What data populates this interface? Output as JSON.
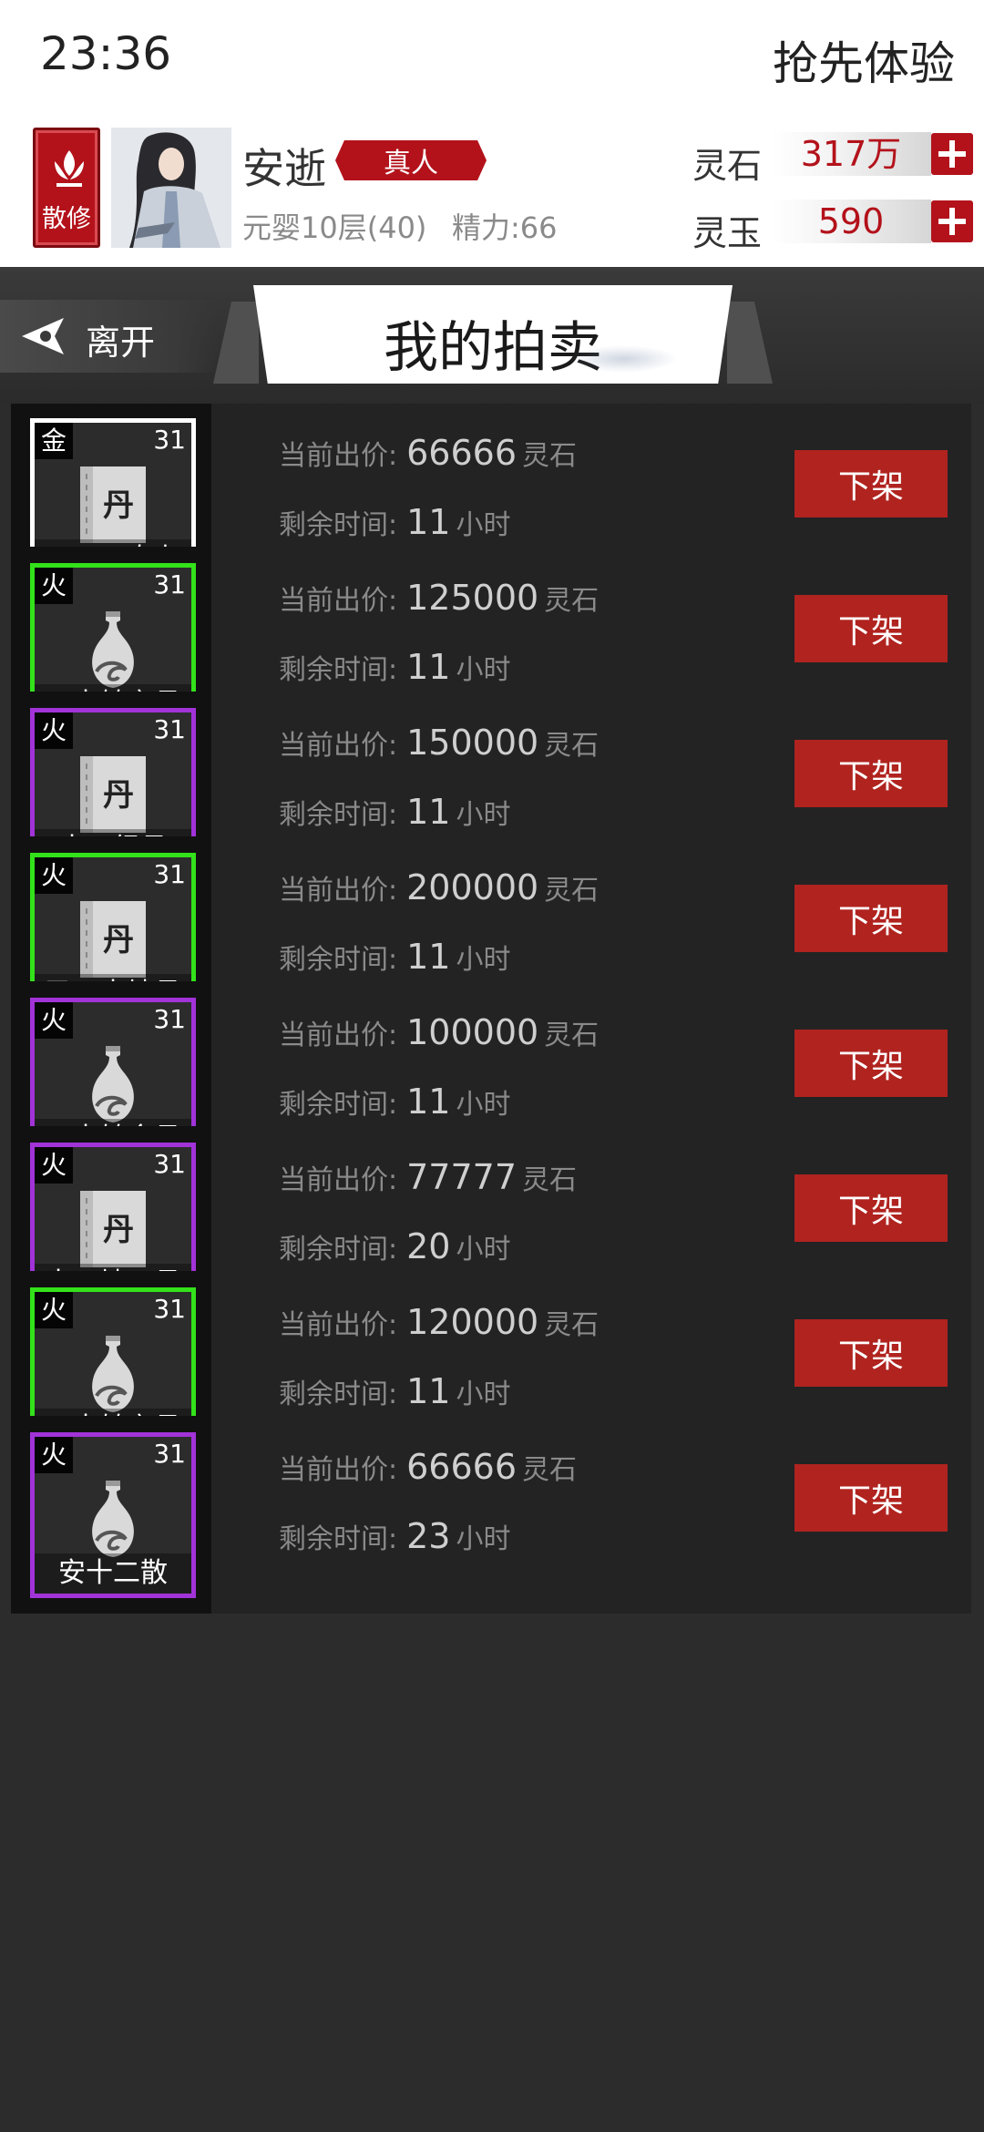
{
  "status_bar": {
    "time": "23:36",
    "right_text": "抢先体验"
  },
  "player": {
    "sect_label": "散修",
    "name": "安逝",
    "rank": "真人",
    "level": "元婴10层(40)",
    "energy": "精力:66"
  },
  "currencies": [
    {
      "label": "灵石",
      "value": "317万"
    },
    {
      "label": "灵玉",
      "value": "590"
    }
  ],
  "title_bar": {
    "leave_label": "离开",
    "title": "我的拍卖"
  },
  "listing_labels": {
    "price": "当前出价:",
    "time": "剩余时间:",
    "hours_unit": "小时",
    "delist_button": "下架"
  },
  "colors": {
    "accent_red": "#b3121b",
    "green_rarity": "#33e21a",
    "purple_rarity": "#a133d8",
    "white_rarity": "#ffffff"
  },
  "listings": [
    {
      "element": "金",
      "level": "31",
      "name": "一二八寿丸",
      "icon": "book-icon",
      "rarity": "white",
      "price": "66666",
      "currency": "灵石",
      "hours": "11"
    },
    {
      "element": "火",
      "level": "31",
      "name": "二十转玄丹",
      "icon": "gourd-icon",
      "rarity": "green",
      "price": "125000",
      "currency": "灵石",
      "hours": "11"
    },
    {
      "element": "火",
      "level": "31",
      "name": "十五经丹",
      "icon": "book-icon",
      "rarity": "purple",
      "price": "150000",
      "currency": "灵石",
      "hours": "11"
    },
    {
      "element": "火",
      "level": "31",
      "name": "又二十地丹",
      "icon": "book-icon",
      "rarity": "green",
      "price": "200000",
      "currency": "灵石",
      "hours": "11"
    },
    {
      "element": "火",
      "level": "31",
      "name": "二十转金丹",
      "icon": "gourd-icon",
      "rarity": "purple",
      "price": "100000",
      "currency": "灵石",
      "hours": "11"
    },
    {
      "element": "火",
      "level": "31",
      "name": "十二地一丹",
      "icon": "book-icon",
      "rarity": "purple",
      "price": "77777",
      "currency": "灵石",
      "hours": "20"
    },
    {
      "element": "火",
      "level": "31",
      "name": "二十转玄丹",
      "icon": "gourd-icon",
      "rarity": "green",
      "price": "120000",
      "currency": "灵石",
      "hours": "11"
    },
    {
      "element": "火",
      "level": "31",
      "name": "安十二散",
      "icon": "gourd-icon",
      "rarity": "purple",
      "price": "66666",
      "currency": "灵石",
      "hours": "23"
    }
  ]
}
